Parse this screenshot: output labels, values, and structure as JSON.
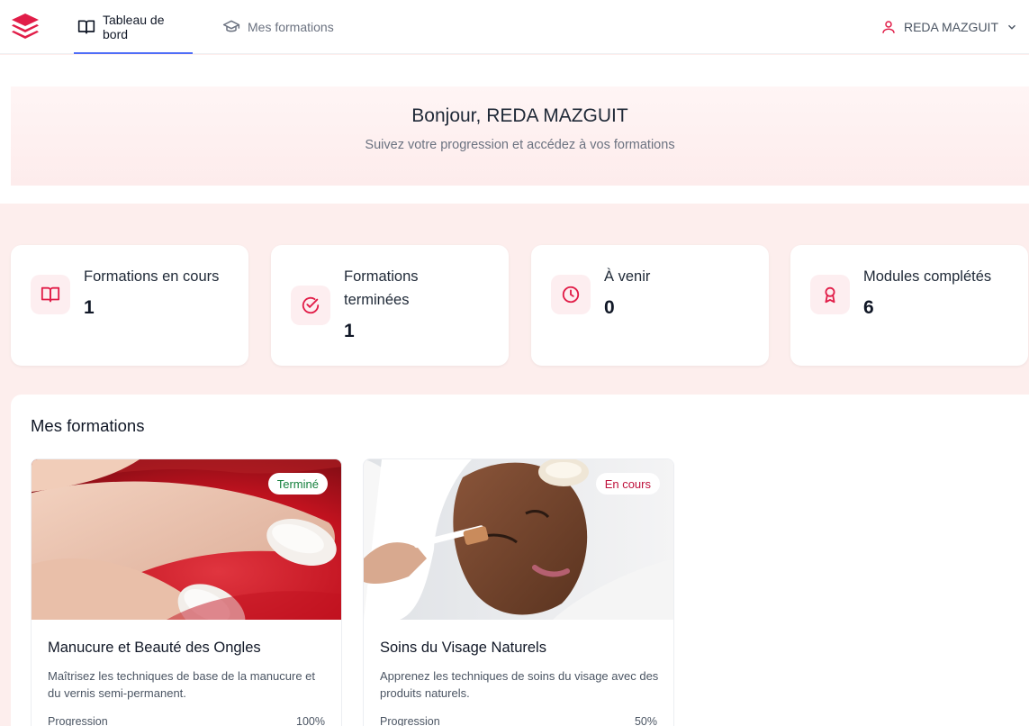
{
  "nav": {
    "tabs": [
      {
        "label": "Tableau de bord",
        "icon": "book-open-icon",
        "active": true
      },
      {
        "label": "Mes formations",
        "icon": "graduation-cap-icon",
        "active": false
      }
    ],
    "user_name": "REDA MAZGUIT"
  },
  "hero": {
    "greeting": "Bonjour, REDA MAZGUIT",
    "subtitle": "Suivez votre progression et accédez à vos formations"
  },
  "stats": [
    {
      "label": "Formations en cours",
      "value": "1",
      "icon": "book-open-icon"
    },
    {
      "label": "Formations terminées",
      "value": "1",
      "icon": "check-circle-icon"
    },
    {
      "label": "À venir",
      "value": "0",
      "icon": "clock-icon"
    },
    {
      "label": "Modules complétés",
      "value": "6",
      "icon": "award-icon"
    }
  ],
  "formations": {
    "heading": "Mes formations",
    "progress_label": "Progression",
    "items": [
      {
        "title": "Manucure et Beauté des Ongles",
        "description": "Maîtrisez les techniques de base de la manucure et du vernis semi-permanent.",
        "status": "Terminé",
        "progress": 100,
        "progress_text": "100%"
      },
      {
        "title": "Soins du Visage Naturels",
        "description": "Apprenez les techniques de soins du visage avec des produits naturels.",
        "status": "En cours",
        "progress": 50,
        "progress_text": "50%"
      }
    ]
  },
  "colors": {
    "brand_red": "#e11d48",
    "active_tab_underline": "#4f6ef7",
    "status_done": "#15803d",
    "status_in_progress": "#be123c",
    "page_background": "#fdeeed"
  }
}
